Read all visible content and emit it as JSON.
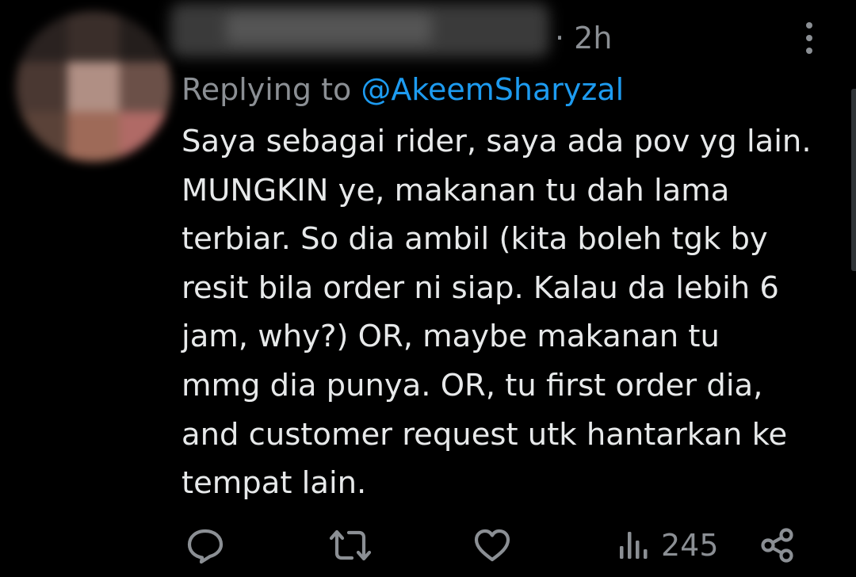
{
  "tweet": {
    "timestamp": "· 2h",
    "replying_prefix": "Replying to ",
    "replying_handle": "@AkeemSharyzal",
    "body_lines": [
      "Saya sebagai rider, saya ada pov yg lain.",
      "MUNGKIN ye, makanan tu dah lama",
      "terbiar. So dia ambil (kita boleh tgk by",
      "resit bila order ni siap. Kalau da lebih 6",
      "jam, why?) OR, maybe makanan tu",
      "mmg dia punya. OR, tu first order dia,",
      "and customer request utk hantarkan ke",
      "tempat lain."
    ]
  },
  "actions": {
    "reply_icon": "reply-icon",
    "retweet_icon": "retweet-icon",
    "like_icon": "heart-icon",
    "views_icon": "views-bar-chart-icon",
    "views_count": "245",
    "share_icon": "share-icon"
  },
  "colors": {
    "background": "#000000",
    "text": "#e7e9ea",
    "muted": "#8b8f94",
    "accent": "#1d9bf0"
  }
}
